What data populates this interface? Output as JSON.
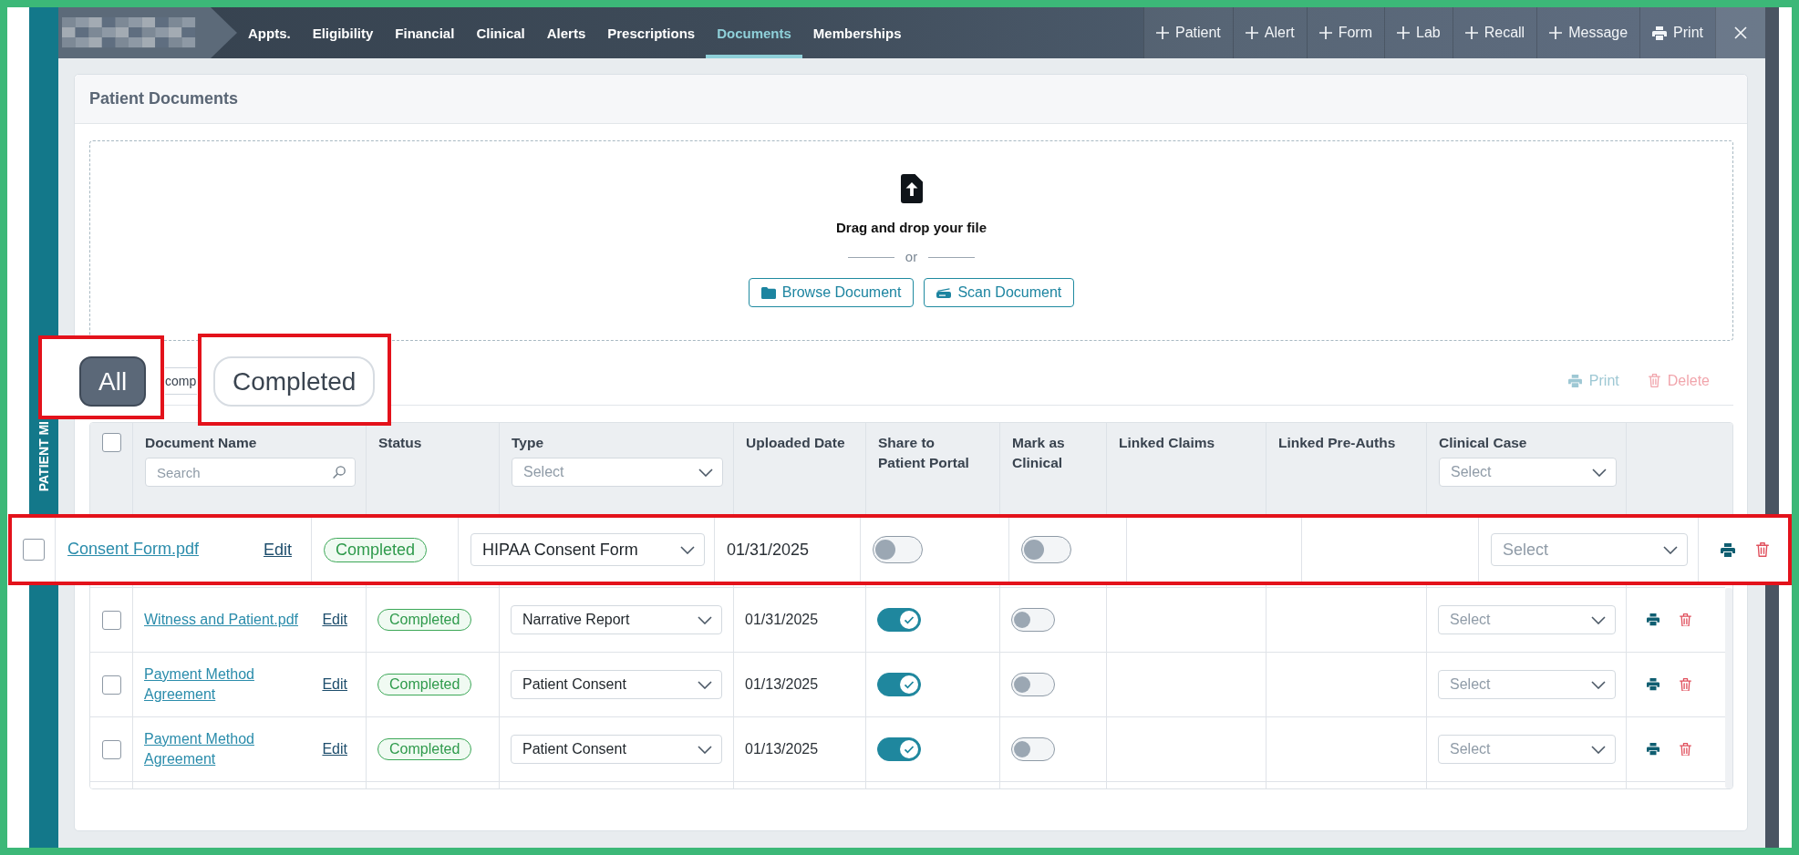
{
  "side_tab": {
    "label": "PATIENT MI"
  },
  "nav": {
    "tabs": [
      {
        "label": "Appts.",
        "selected": false
      },
      {
        "label": "Eligibility",
        "selected": false
      },
      {
        "label": "Financial",
        "selected": false
      },
      {
        "label": "Clinical",
        "selected": false
      },
      {
        "label": "Alerts",
        "selected": false
      },
      {
        "label": "Prescriptions",
        "selected": false
      },
      {
        "label": "Documents",
        "selected": true
      },
      {
        "label": "Memberships",
        "selected": false
      }
    ],
    "actions": [
      {
        "kind": "add",
        "label": "Patient"
      },
      {
        "kind": "add",
        "label": "Alert"
      },
      {
        "kind": "add",
        "label": "Form"
      },
      {
        "kind": "add",
        "label": "Lab"
      },
      {
        "kind": "add",
        "label": "Recall"
      },
      {
        "kind": "add",
        "label": "Message"
      },
      {
        "kind": "print",
        "label": "Print"
      },
      {
        "kind": "close"
      }
    ]
  },
  "card": {
    "title": "Patient Documents"
  },
  "upload": {
    "prompt": "Drag and drop your file",
    "separator": "or",
    "buttons": [
      {
        "kind": "browse",
        "label": "Browse Document"
      },
      {
        "kind": "scan",
        "label": "Scan Document"
      }
    ]
  },
  "filter": {
    "chip_fragment": "comp"
  },
  "bulk_actions": [
    {
      "kind": "print",
      "label": "Print",
      "disabled": true
    },
    {
      "kind": "delete",
      "label": "Delete",
      "disabled": true
    }
  ],
  "table": {
    "select_all": {
      "checked": false
    },
    "columns": [
      {
        "label": "Document Name",
        "filter": {
          "kind": "search",
          "placeholder": "Search"
        }
      },
      {
        "label": "Status"
      },
      {
        "label": "Type",
        "filter": {
          "kind": "select",
          "placeholder": "Select"
        }
      },
      {
        "label": "Uploaded Date"
      },
      {
        "label": "Share to Patient Portal"
      },
      {
        "label": "Mark as Clinical"
      },
      {
        "label": "Linked Claims"
      },
      {
        "label": "Linked Pre-Auths"
      },
      {
        "label": "Clinical Case",
        "filter": {
          "kind": "select",
          "placeholder": "Select"
        }
      }
    ],
    "rows": [
      {
        "checked": false,
        "name": "Witness and Patient.pdf",
        "edit": "Edit",
        "status": "Completed",
        "type": "Narrative Report",
        "uploaded": "01/31/2025",
        "shared": true,
        "clinical": false,
        "clinical_case": {
          "placeholder": "Select"
        }
      },
      {
        "checked": false,
        "name": "Payment Method Agreement",
        "edit": "Edit",
        "status": "Completed",
        "type": "Patient Consent",
        "uploaded": "01/13/2025",
        "shared": true,
        "clinical": false,
        "clinical_case": {
          "placeholder": "Select"
        }
      },
      {
        "checked": false,
        "name": "Payment Method Agreement",
        "edit": "Edit",
        "status": "Completed",
        "type": "Patient Consent",
        "uploaded": "01/13/2025",
        "shared": true,
        "clinical": false,
        "clinical_case": {
          "placeholder": "Select"
        }
      }
    ]
  },
  "callouts": {
    "chips": [
      {
        "label": "All",
        "selected": true
      },
      {
        "label": "Completed",
        "selected": false
      }
    ],
    "row": {
      "checked": false,
      "name": "Consent Form.pdf",
      "edit": "Edit",
      "status": "Completed",
      "type": "HIPAA Consent Form",
      "uploaded": "01/31/2025",
      "shared": false,
      "clinical": false,
      "clinical_case": {
        "placeholder": "Select"
      }
    }
  }
}
